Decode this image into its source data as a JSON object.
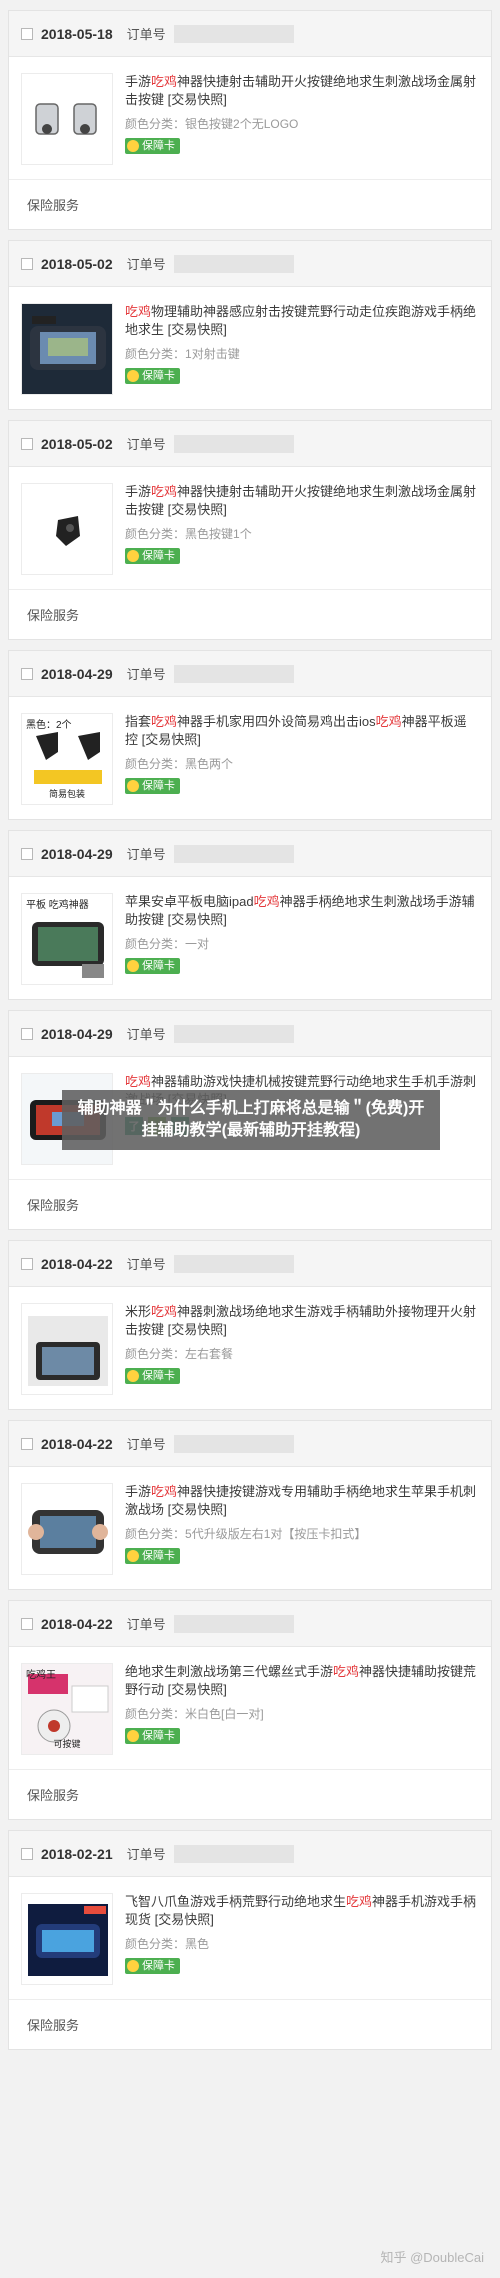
{
  "order_label": "订单号",
  "service_label": "保险服务",
  "badge_text": "保障卡",
  "sku_prefix": "颜色分类：",
  "overlay_text": "辅助神器＂为什么手机上打麻将总是输＂(免费)开挂辅助教学(最新辅助开挂教程)",
  "watermark": "知乎 @DoubleCai",
  "colors": {
    "highlight": "#e4393c",
    "badge": "#4caf50",
    "background": "#f2f2f2"
  },
  "orders": [
    {
      "date": "2018-05-18",
      "title_parts": [
        "手游",
        "吃鸡",
        "神器快捷射击辅助开火按键绝地求生刺激战场金属射击按键 [交易快照]"
      ],
      "sku": "银色按键2个无LOGO",
      "badge": true,
      "footer": true,
      "thumb": "silver-triggers"
    },
    {
      "date": "2018-05-02",
      "title_parts": [
        "",
        "吃鸡",
        "物理辅助神器感应射击按键荒野行动走位疾跑游戏手柄绝地求生 [交易快照]"
      ],
      "sku": "1对射击键",
      "badge": true,
      "footer": false,
      "thumb": "phone-gamepad"
    },
    {
      "date": "2018-05-02",
      "title_parts": [
        "手游",
        "吃鸡",
        "神器快捷射击辅助开火按键绝地求生刺激战场金属射击按键 [交易快照]"
      ],
      "sku": "黑色按键1个",
      "badge": true,
      "footer": true,
      "thumb": "black-trigger"
    },
    {
      "date": "2018-04-29",
      "title_parts": [
        "指套",
        "吃鸡",
        "神器手机家用四外设简易鸡出击ios",
        "吃鸡",
        "神器平板遥控 [交易快照]"
      ],
      "sku": "黑色两个",
      "badge": true,
      "footer": false,
      "thumb": "black-pair",
      "thumb_caption": "黑色：2个",
      "thumb_sub": "简易包装"
    },
    {
      "date": "2018-04-29",
      "title_parts": [
        "苹果安卓平板电脑ipad",
        "吃鸡",
        "神器手柄绝地求生刺激战场手游辅助按键 [交易快照]"
      ],
      "sku": "一对",
      "badge": true,
      "footer": false,
      "thumb": "tablet",
      "thumb_caption": "平板 吃鸡神器"
    },
    {
      "date": "2018-04-29",
      "title_parts": [
        "",
        "吃鸡",
        "神器辅助游戏快捷机械按键荒野行动绝地求生手机手游刺激战场 [交易快照]"
      ],
      "sku": "",
      "badge": false,
      "service_icons": [
        "了",
        "U",
        "正"
      ],
      "footer": true,
      "thumb": "phone-red"
    },
    {
      "date": "2018-04-22",
      "title_parts": [
        "米形",
        "吃鸡",
        "神器刺激战场绝地求生游戏手柄辅助外接物理开火射击按键 [交易快照]"
      ],
      "sku": "左右套餐",
      "badge": true,
      "footer": false,
      "thumb": "mi-grid"
    },
    {
      "date": "2018-04-22",
      "title_parts": [
        "手游",
        "吃鸡",
        "神器快捷按键游戏专用辅助手柄绝地求生苹果手机刺激战场 [交易快照]"
      ],
      "sku": "5代升级版左右1对【按压卡扣式】",
      "badge": true,
      "footer": false,
      "thumb": "hand-grip"
    },
    {
      "date": "2018-04-22",
      "title_parts": [
        "绝地求生刺激战场第三代螺丝式手游",
        "吃鸡",
        "神器快捷辅助按键荒野行动 [交易快照]"
      ],
      "sku": "米白色[白一对]",
      "badge": true,
      "footer": true,
      "thumb": "screw-type",
      "thumb_caption": "吃鸡王",
      "thumb_sub": "可按键"
    },
    {
      "date": "2018-02-21",
      "title_parts": [
        "飞智八爪鱼游戏手柄荒野行动绝地求生",
        "吃鸡",
        "神器手机游戏手柄现货 [交易快照]"
      ],
      "sku": "黑色",
      "badge": true,
      "footer": true,
      "thumb": "octopus"
    }
  ]
}
